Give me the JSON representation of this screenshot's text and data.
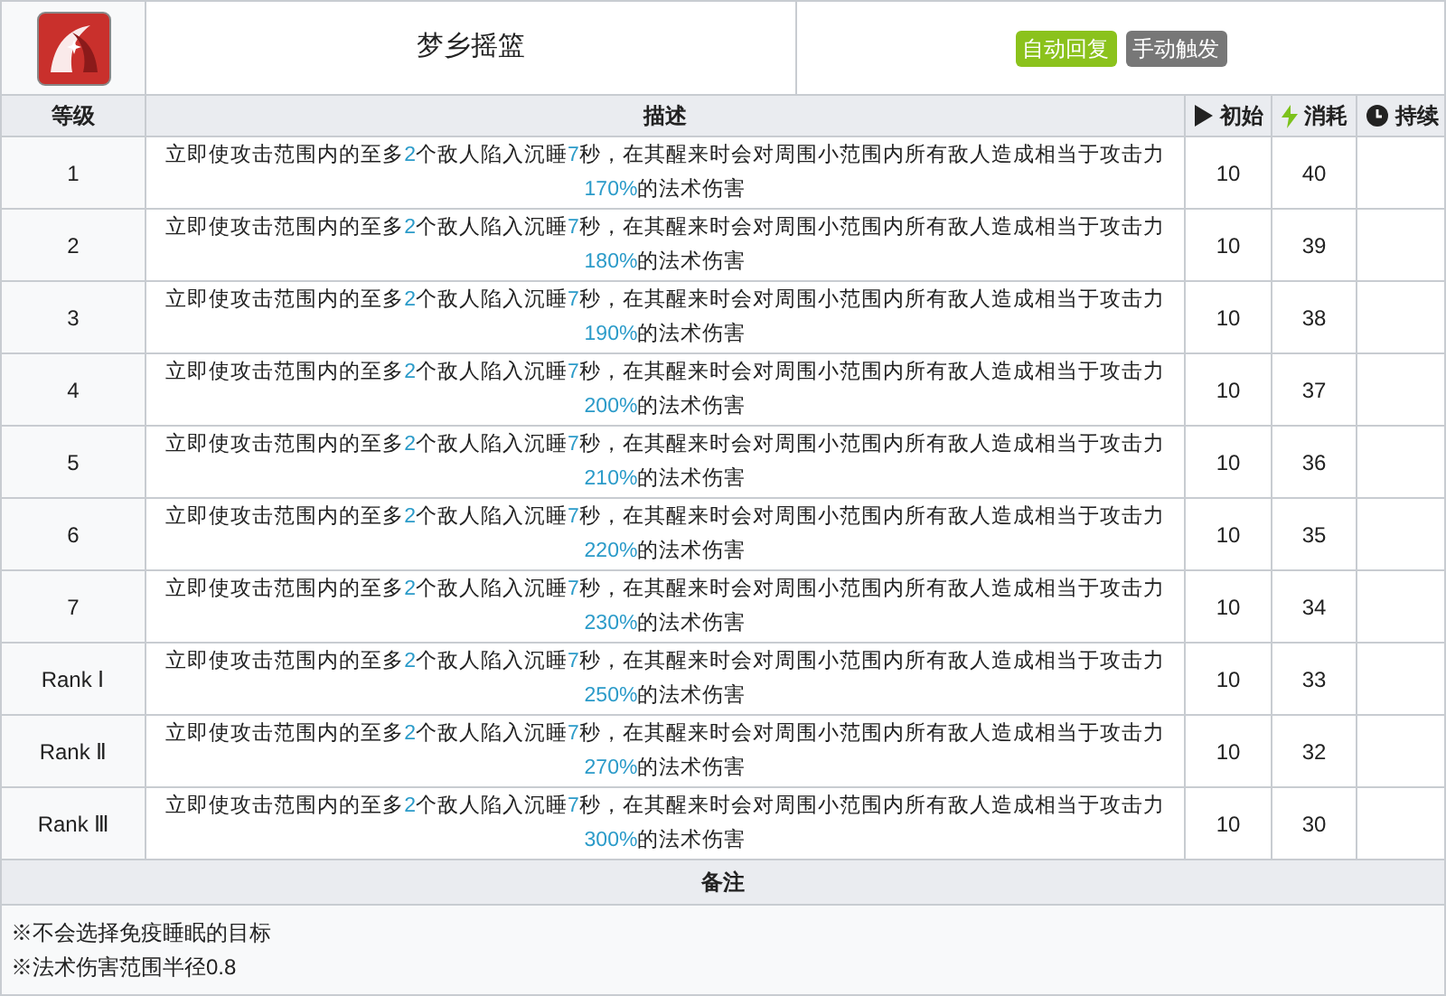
{
  "skill": {
    "name": "梦乡摇篮",
    "tags": [
      {
        "label": "自动回复",
        "color": "#8bc21c"
      },
      {
        "label": "手动触发",
        "color": "#777777"
      }
    ]
  },
  "columns": [
    {
      "label": "等级"
    },
    {
      "label": "描述"
    },
    {
      "label": "初始"
    },
    {
      "label": "消耗"
    },
    {
      "label": "持续"
    }
  ],
  "rows": [
    {
      "level": "1",
      "description": [
        {
          "text": "立即使攻击范围内的至多",
          "hl": false
        },
        {
          "text": "2",
          "hl": true
        },
        {
          "text": "个敌人陷入沉睡",
          "hl": false
        },
        {
          "text": "7",
          "hl": true
        },
        {
          "text": "秒，在其醒来时会对周围小范围内所有敌人造成相当于攻击力",
          "hl": false
        },
        {
          "text": "170%",
          "hl": true
        },
        {
          "text": "的法术伤害",
          "hl": false
        }
      ],
      "initial": "10",
      "cost": "40"
    },
    {
      "level": "2",
      "description": [
        {
          "text": "立即使攻击范围内的至多",
          "hl": false
        },
        {
          "text": "2",
          "hl": true
        },
        {
          "text": "个敌人陷入沉睡",
          "hl": false
        },
        {
          "text": "7",
          "hl": true
        },
        {
          "text": "秒，在其醒来时会对周围小范围内所有敌人造成相当于攻击力",
          "hl": false
        },
        {
          "text": "180%",
          "hl": true
        },
        {
          "text": "的法术伤害",
          "hl": false
        }
      ],
      "initial": "10",
      "cost": "39"
    },
    {
      "level": "3",
      "description": [
        {
          "text": "立即使攻击范围内的至多",
          "hl": false
        },
        {
          "text": "2",
          "hl": true
        },
        {
          "text": "个敌人陷入沉睡",
          "hl": false
        },
        {
          "text": "7",
          "hl": true
        },
        {
          "text": "秒，在其醒来时会对周围小范围内所有敌人造成相当于攻击力",
          "hl": false
        },
        {
          "text": "190%",
          "hl": true
        },
        {
          "text": "的法术伤害",
          "hl": false
        }
      ],
      "initial": "10",
      "cost": "38"
    },
    {
      "level": "4",
      "description": [
        {
          "text": "立即使攻击范围内的至多",
          "hl": false
        },
        {
          "text": "2",
          "hl": true
        },
        {
          "text": "个敌人陷入沉睡",
          "hl": false
        },
        {
          "text": "7",
          "hl": true
        },
        {
          "text": "秒，在其醒来时会对周围小范围内所有敌人造成相当于攻击力",
          "hl": false
        },
        {
          "text": "200%",
          "hl": true
        },
        {
          "text": "的法术伤害",
          "hl": false
        }
      ],
      "initial": "10",
      "cost": "37"
    },
    {
      "level": "5",
      "description": [
        {
          "text": "立即使攻击范围内的至多",
          "hl": false
        },
        {
          "text": "2",
          "hl": true
        },
        {
          "text": "个敌人陷入沉睡",
          "hl": false
        },
        {
          "text": "7",
          "hl": true
        },
        {
          "text": "秒，在其醒来时会对周围小范围内所有敌人造成相当于攻击力",
          "hl": false
        },
        {
          "text": "210%",
          "hl": true
        },
        {
          "text": "的法术伤害",
          "hl": false
        }
      ],
      "initial": "10",
      "cost": "36"
    },
    {
      "level": "6",
      "description": [
        {
          "text": "立即使攻击范围内的至多",
          "hl": false
        },
        {
          "text": "2",
          "hl": true
        },
        {
          "text": "个敌人陷入沉睡",
          "hl": false
        },
        {
          "text": "7",
          "hl": true
        },
        {
          "text": "秒，在其醒来时会对周围小范围内所有敌人造成相当于攻击力",
          "hl": false
        },
        {
          "text": "220%",
          "hl": true
        },
        {
          "text": "的法术伤害",
          "hl": false
        }
      ],
      "initial": "10",
      "cost": "35"
    },
    {
      "level": "7",
      "description": [
        {
          "text": "立即使攻击范围内的至多",
          "hl": false
        },
        {
          "text": "2",
          "hl": true
        },
        {
          "text": "个敌人陷入沉睡",
          "hl": false
        },
        {
          "text": "7",
          "hl": true
        },
        {
          "text": "秒，在其醒来时会对周围小范围内所有敌人造成相当于攻击力",
          "hl": false
        },
        {
          "text": "230%",
          "hl": true
        },
        {
          "text": "的法术伤害",
          "hl": false
        }
      ],
      "initial": "10",
      "cost": "34"
    },
    {
      "level": "Rank Ⅰ",
      "description": [
        {
          "text": "立即使攻击范围内的至多",
          "hl": false
        },
        {
          "text": "2",
          "hl": true
        },
        {
          "text": "个敌人陷入沉睡",
          "hl": false
        },
        {
          "text": "7",
          "hl": true
        },
        {
          "text": "秒，在其醒来时会对周围小范围内所有敌人造成相当于攻击力",
          "hl": false
        },
        {
          "text": "250%",
          "hl": true
        },
        {
          "text": "的法术伤害",
          "hl": false
        }
      ],
      "initial": "10",
      "cost": "33"
    },
    {
      "level": "Rank Ⅱ",
      "description": [
        {
          "text": "立即使攻击范围内的至多",
          "hl": false
        },
        {
          "text": "2",
          "hl": true
        },
        {
          "text": "个敌人陷入沉睡",
          "hl": false
        },
        {
          "text": "7",
          "hl": true
        },
        {
          "text": "秒，在其醒来时会对周围小范围内所有敌人造成相当于攻击力",
          "hl": false
        },
        {
          "text": "270%",
          "hl": true
        },
        {
          "text": "的法术伤害",
          "hl": false
        }
      ],
      "initial": "10",
      "cost": "32"
    },
    {
      "level": "Rank Ⅲ",
      "description": [
        {
          "text": "立即使攻击范围内的至多",
          "hl": false
        },
        {
          "text": "2",
          "hl": true
        },
        {
          "text": "个敌人陷入沉睡",
          "hl": false
        },
        {
          "text": "7",
          "hl": true
        },
        {
          "text": "秒，在其醒来时会对周围小范围内所有敌人造成相当于攻击力",
          "hl": false
        },
        {
          "text": "300%",
          "hl": true
        },
        {
          "text": "的法术伤害",
          "hl": false
        }
      ],
      "initial": "10",
      "cost": "30"
    }
  ],
  "notes": {
    "title": "备注",
    "lines": [
      "※不会选择免疫睡眠的目标",
      "※法术伤害范围半径0.8"
    ]
  }
}
